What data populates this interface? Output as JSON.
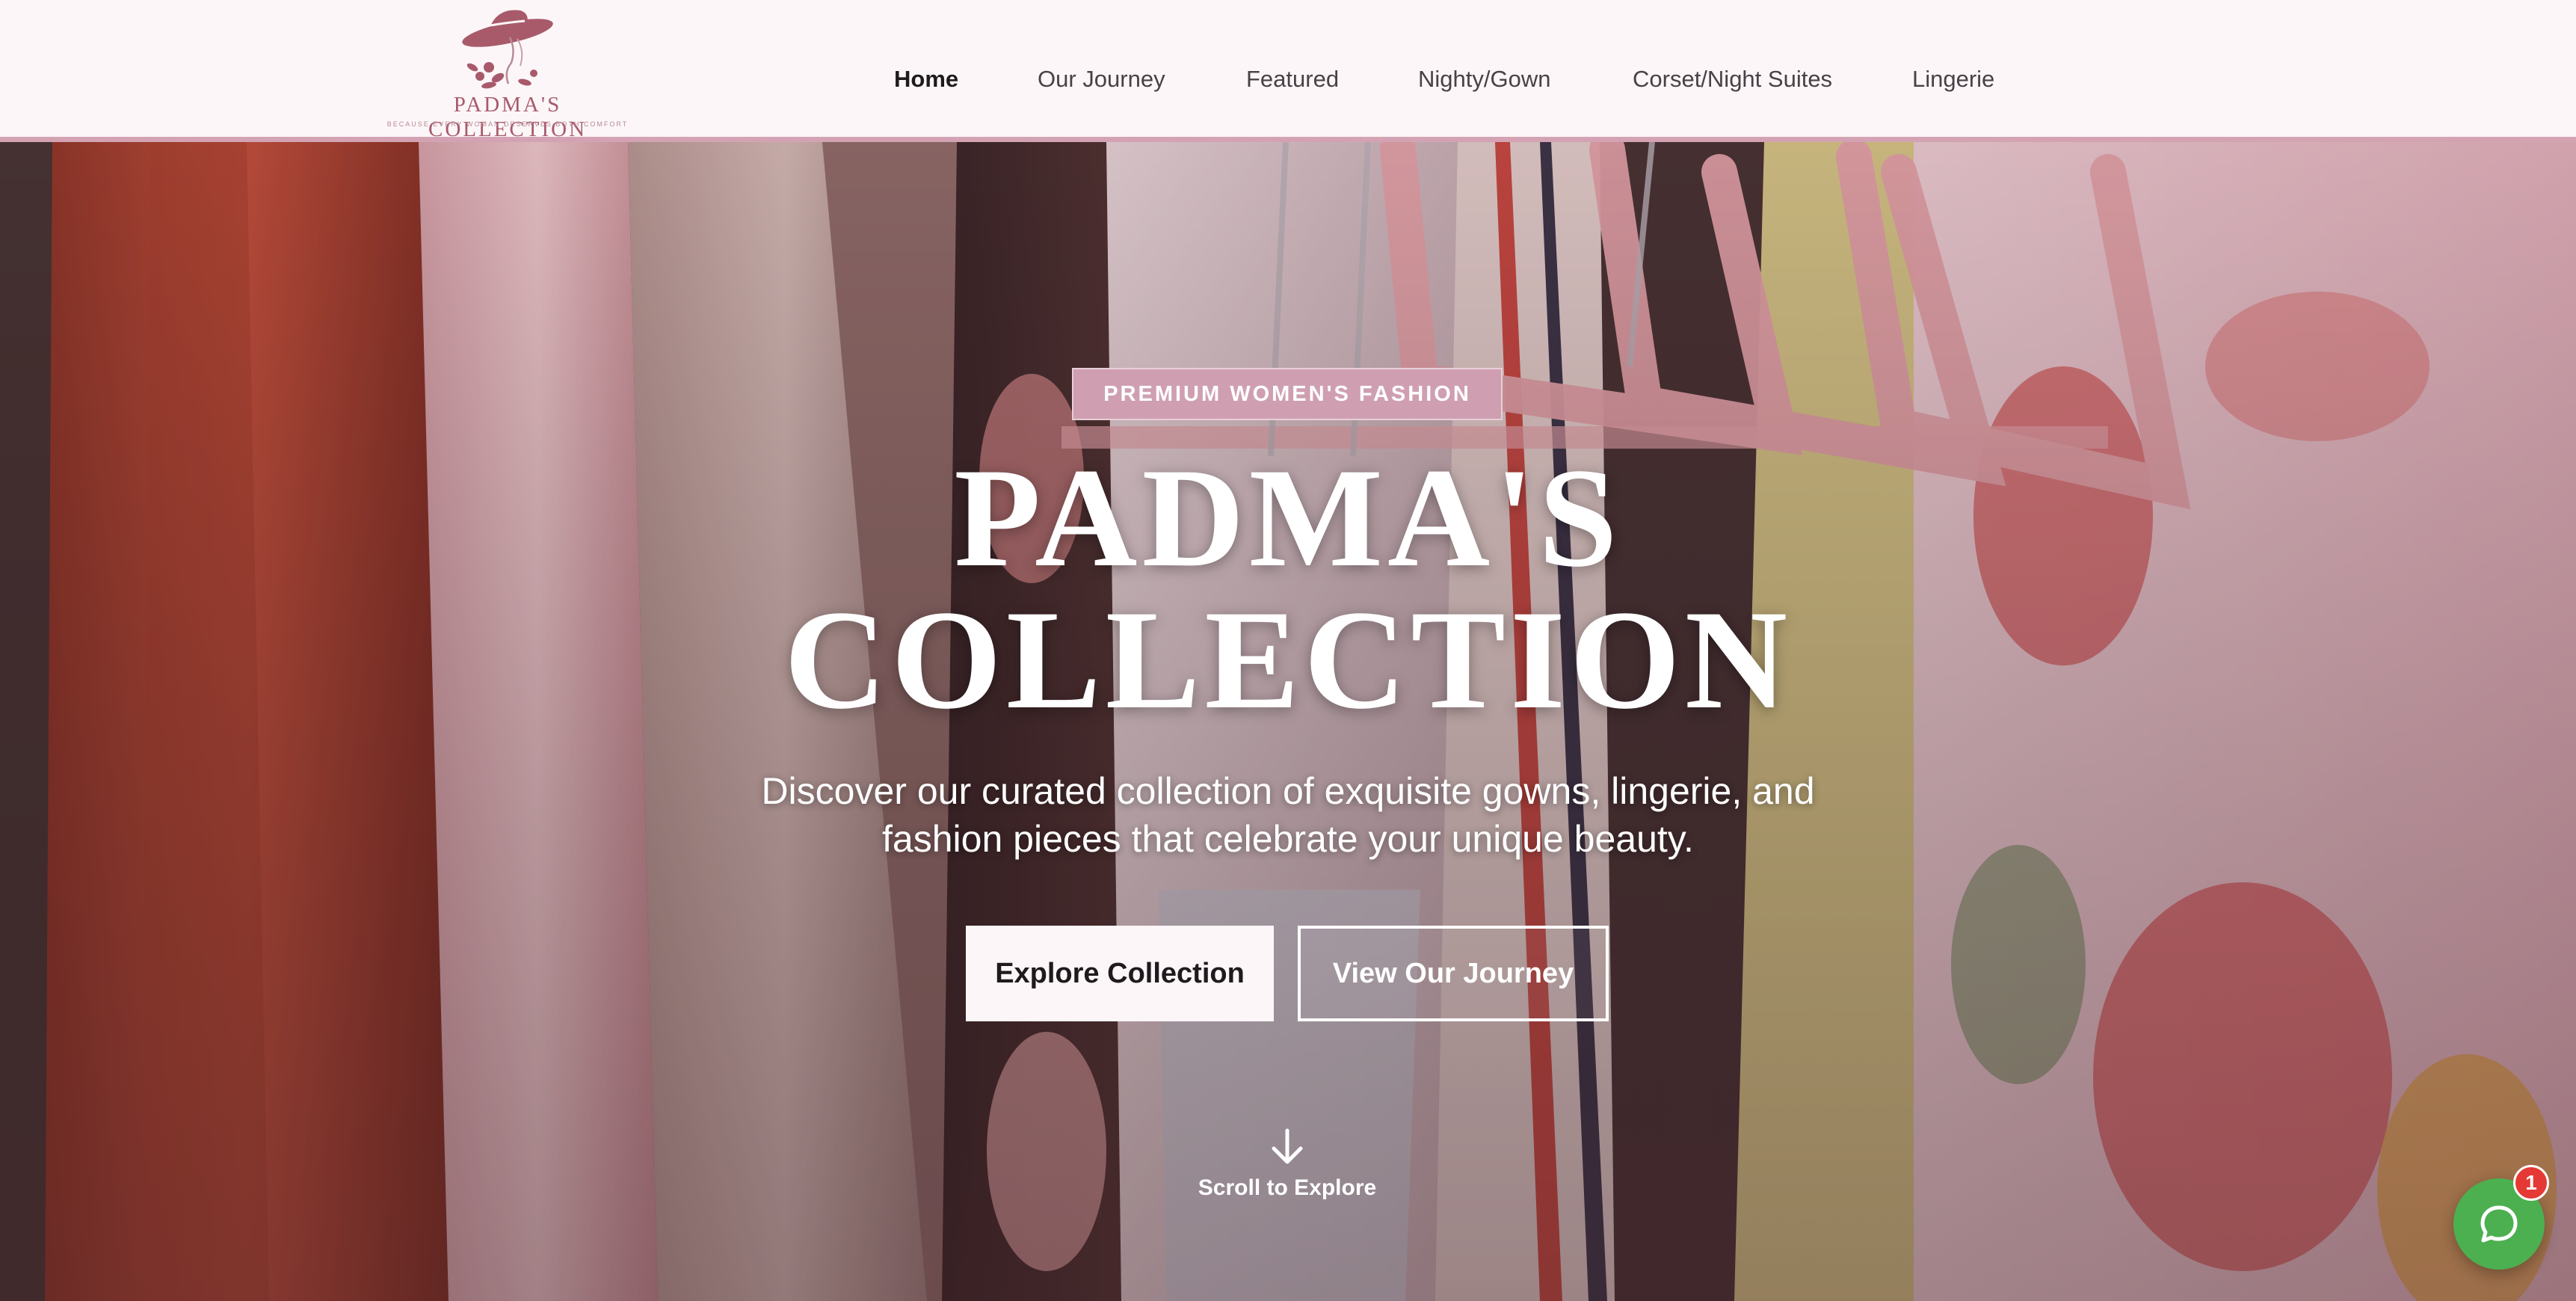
{
  "brand": {
    "name": "PADMA'S COLLECTION",
    "tagline": "Because every woman deserves both comfort"
  },
  "nav": {
    "items": [
      {
        "label": "Home",
        "active": true
      },
      {
        "label": "Our Journey",
        "active": false
      },
      {
        "label": "Featured",
        "active": false
      },
      {
        "label": "Nighty/Gown",
        "active": false
      },
      {
        "label": "Corset/Night Suites",
        "active": false
      },
      {
        "label": "Lingerie",
        "active": false
      }
    ]
  },
  "hero": {
    "badge": "PREMIUM WOMEN'S FASHION",
    "title_line1": "PADMA'S",
    "title_line2": "COLLECTION",
    "subtitle": "Discover our curated collection of exquisite gowns, lingerie, and fashion pieces that celebrate your unique beauty.",
    "primary_button": "Explore Collection",
    "secondary_button": "View Our Journey",
    "scroll_label": "Scroll to Explore"
  },
  "chat": {
    "unread_count": "1",
    "icon": "chat-bubble-icon"
  },
  "colors": {
    "accent": "#cf9fb1",
    "brand": "#a85a6b",
    "chat": "#4caf50",
    "notification": "#e53935"
  }
}
